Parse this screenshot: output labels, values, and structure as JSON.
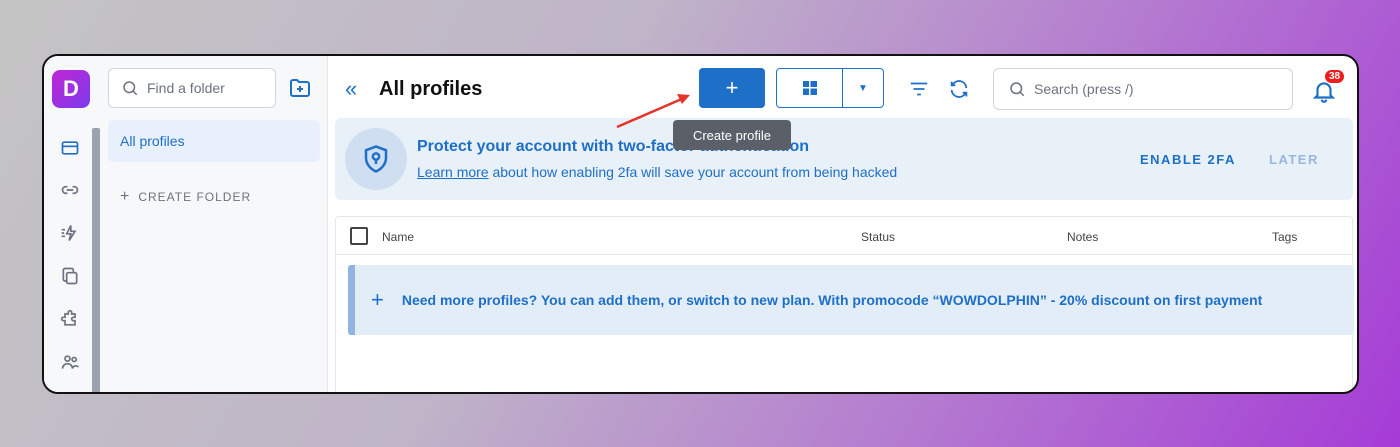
{
  "app": {
    "logo_letter": "D",
    "accent": "#1e6fc7",
    "brand_gradient": [
      "#c026d3",
      "#7c3aed"
    ]
  },
  "rail": {
    "icons": [
      "profiles-icon",
      "link-icon",
      "automation-icon",
      "copy-icon",
      "extensions-icon",
      "team-icon"
    ]
  },
  "folders": {
    "search_placeholder": "Find a folder",
    "all_profiles": "All profiles",
    "create_folder": "CREATE FOLDER"
  },
  "header": {
    "title": "All profiles",
    "create_button": "+",
    "search_placeholder": "Search (press /)",
    "notifications_count": "38"
  },
  "tooltip": {
    "text": "Create profile"
  },
  "banner": {
    "title": "Protect your account with two-factor authentication",
    "learn_more": "Learn more",
    "subtitle_rest": " about how enabling 2fa will save your account from being hacked",
    "enable_button": "ENABLE 2FA",
    "later_button": "LATER"
  },
  "table": {
    "columns": [
      "Name",
      "Status",
      "Notes",
      "Tags"
    ]
  },
  "promo": {
    "text": "Need more profiles? You can add them, or switch to new plan. With promocode “WOWDOLPHIN” - 20% discount on first payment"
  },
  "annotation": {
    "arrow_color": "#e5342b"
  }
}
